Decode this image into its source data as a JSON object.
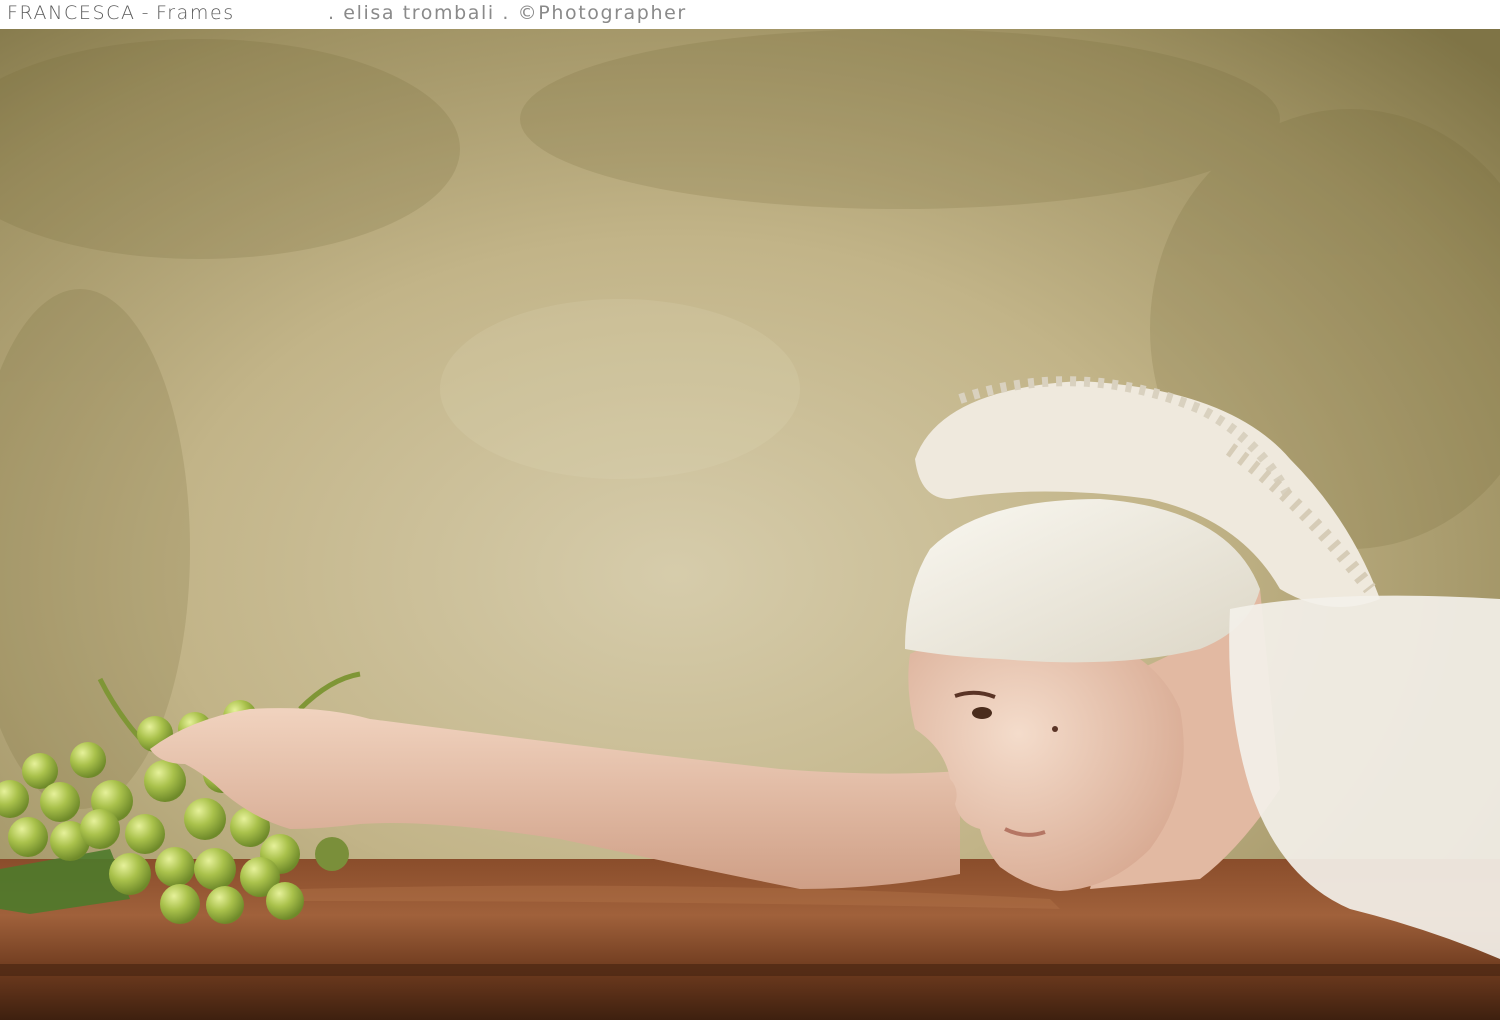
{
  "header": {
    "title": "FRANCESCA",
    "separator": "-",
    "section": "Frames",
    "photographer": ". elisa trombali .",
    "copyright": "©Photographer"
  },
  "photo": {
    "subject_icons": [
      "grapes-icon",
      "hand-icon",
      "head-wrap-icon",
      "table-icon"
    ],
    "palette": {
      "wall_dark": "#8b7f4f",
      "wall_light": "#d2c7a2",
      "table": "#6b3a1f",
      "table_highlight": "#9a5a36",
      "grapes": "#a8c04a",
      "skin": "#e9c7b1",
      "cloth": "#f2efe6"
    }
  }
}
